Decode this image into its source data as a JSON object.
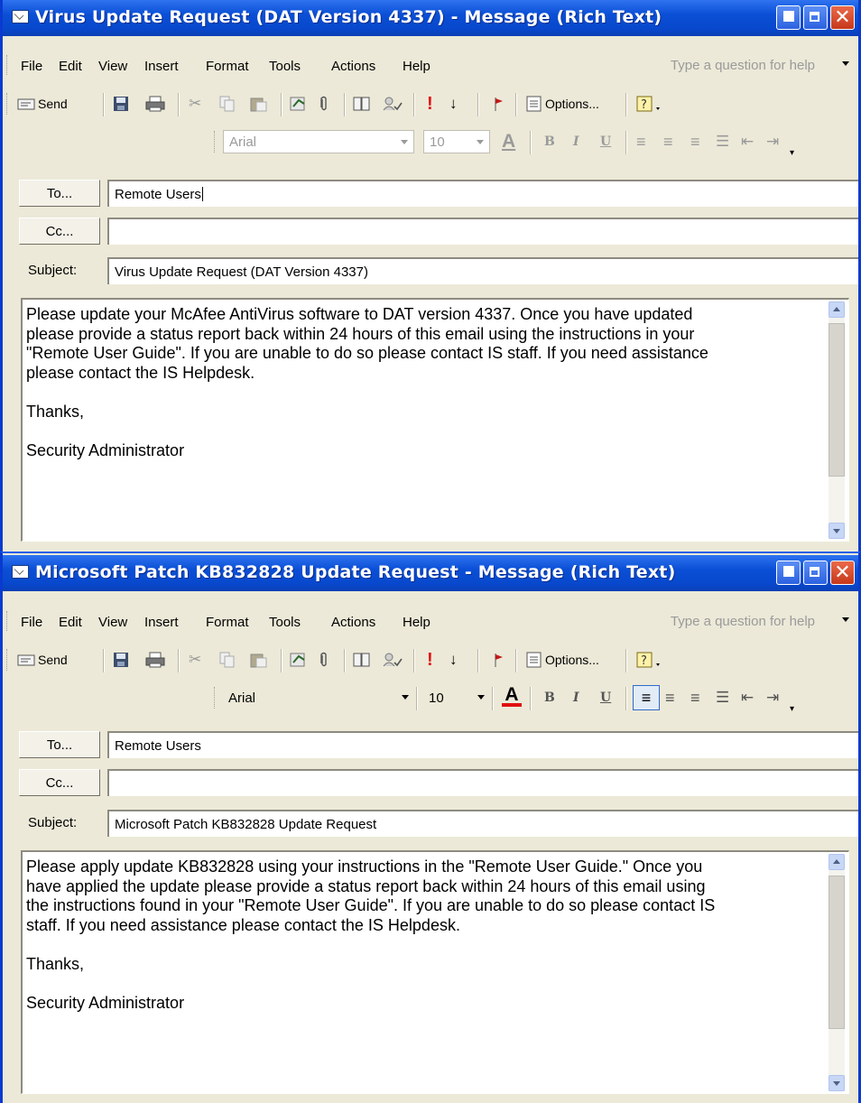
{
  "windows": [
    {
      "title": "Virus Update Request (DAT Version 4337) - Message (Rich Text)",
      "menu": [
        "File",
        "Edit",
        "View",
        "Insert",
        "Format",
        "Tools",
        "Actions",
        "Help"
      ],
      "help_placeholder": "Type a question for help",
      "toolbar": {
        "send_label": "Send",
        "options_label": "Options..."
      },
      "format": {
        "font": "Arial",
        "size": "10",
        "enabled": false
      },
      "to_button": "To...",
      "cc_button": "Cc...",
      "to_value": "Remote Users",
      "cc_value": "",
      "subject_label": "Subject:",
      "subject_value": "Virus Update Request (DAT Version 4337)",
      "body": "Please update your McAfee AntiVirus software to DAT version 4337. Once you have updated\nplease provide a status report back within 24 hours of this email using the instructions in your\n\"Remote User Guide\". If you are unable to do so please contact IS staff. If you need assistance\nplease contact the IS Helpdesk.\n\nThanks,\n\nSecurity Administrator"
    },
    {
      "title": "Microsoft Patch KB832828 Update Request - Message (Rich Text)",
      "menu": [
        "File",
        "Edit",
        "View",
        "Insert",
        "Format",
        "Tools",
        "Actions",
        "Help"
      ],
      "help_placeholder": "Type a question for help",
      "toolbar": {
        "send_label": "Send",
        "options_label": "Options..."
      },
      "format": {
        "font": "Arial",
        "size": "10",
        "enabled": true
      },
      "to_button": "To...",
      "cc_button": "Cc...",
      "to_value": "Remote Users",
      "cc_value": "",
      "subject_label": "Subject:",
      "subject_value": "Microsoft Patch KB832828 Update Request",
      "body": "Please apply update KB832828 using your instructions in the \"Remote User Guide.\" Once you\nhave applied the update please provide a status report back within 24 hours of this email using\nthe instructions found in your \"Remote User Guide\". If you are unable to do so please contact IS\nstaff. If you need assistance please contact the IS Helpdesk.\n\nThanks,\n\nSecurity Administrator"
    }
  ],
  "colors": {
    "titlebar": "#0a4fd6",
    "chrome": "#ece9d8",
    "importance_red": "#e01010",
    "font_color_red": "#e01010"
  }
}
